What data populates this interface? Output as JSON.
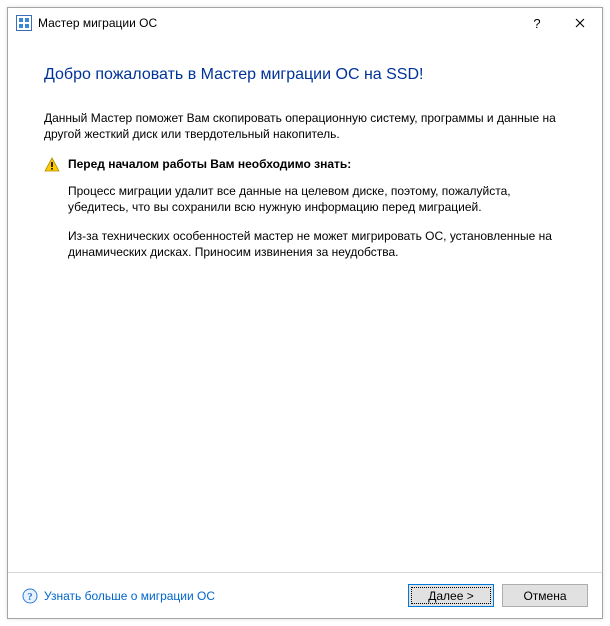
{
  "titlebar": {
    "title": "Мастер миграции ОС"
  },
  "content": {
    "heading": "Добро пожаловать в Мастер миграции ОС на SSD!",
    "intro": "Данный Мастер поможет Вам скопировать операционную систему, программы и данные на другой жесткий диск или твердотельный накопитель.",
    "warning_label": "Перед началом работы Вам необходимо знать:",
    "paragraph1": "Процесс миграции удалит все данные на целевом диске, поэтому, пожалуйста, убедитесь, что вы сохранили всю нужную информацию перед миграцией.",
    "paragraph2": "Из-за технических особенностей мастер не может мигрировать ОС, установленные на динамических дисках. Приносим извинения за неудобства."
  },
  "footer": {
    "help_link": "Узнать больше о миграции ОС",
    "next_button": "Далее >",
    "cancel_button": "Отмена"
  }
}
